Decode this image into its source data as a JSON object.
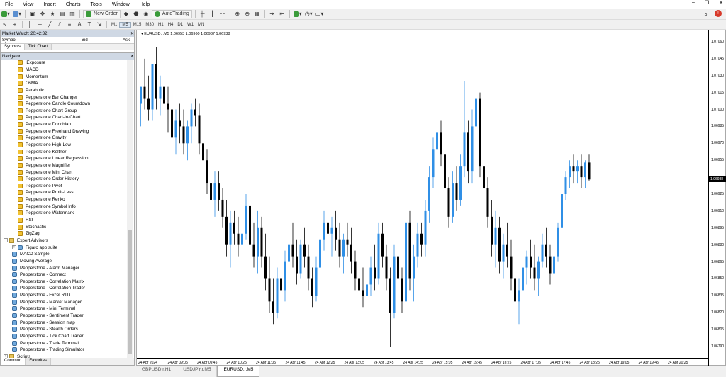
{
  "menu": [
    "File",
    "View",
    "Insert",
    "Charts",
    "Tools",
    "Window",
    "Help"
  ],
  "toolbar": {
    "new_order_label": "New Order",
    "autotrading_label": "AutoTrading",
    "timeframes": [
      "M1",
      "M5",
      "M15",
      "M30",
      "H1",
      "H4",
      "D1",
      "W1",
      "MN"
    ],
    "active_timeframe": "M5"
  },
  "market_watch": {
    "title": "Market Watch: 20:42:32",
    "col_symbol": "Symbol",
    "col_bid": "Bid",
    "col_ask": "Ask",
    "tabs": [
      "Symbols",
      "Tick Chart"
    ]
  },
  "navigator": {
    "title": "Navigator",
    "indicators": [
      "iExposure",
      "MACD",
      "Momentum",
      "OsMA",
      "Parabolic",
      "Pepperstone Bar Changer",
      "Pepperstone Candle Countdown",
      "Pepperstone Chart Group",
      "Pepperstone Chart-In-Chart",
      "Pepperstone Donchian",
      "Pepperstone Freehand Drawing",
      "Pepperstone Gravity",
      "Pepperstone High-Low",
      "Pepperstone Keltner",
      "Pepperstone Linear Regression",
      "Pepperstone Magnifier",
      "Pepperstone Mini Chart",
      "Pepperstone Order History",
      "Pepperstone Pivot",
      "Pepperstone Profit-Less",
      "Pepperstone Renko",
      "Pepperstone Symbol Info",
      "Pepperstone Watermark",
      "RSI",
      "Stochastic",
      "ZigZag"
    ],
    "ea_folder": "Expert Advisors",
    "experts": [
      "Figaro app suite",
      "MACD Sample",
      "Moving Average",
      "Pepperstone - Alarm Manager",
      "Pepperstone - Connect",
      "Pepperstone - Correlation Matrix",
      "Pepperstone - Correlation Trader",
      "Pepperstone - Excel RTD",
      "Pepperstone - Market Manager",
      "Pepperstone - Mini Terminal",
      "Pepperstone - Sentiment Trader",
      "Pepperstone - Session map",
      "Pepperstone - Stealth Orders",
      "Pepperstone - Tick Chart Trader",
      "Pepperstone - Trade Terminal",
      "Pepperstone - Trading Simulator"
    ],
    "scripts_folder": "Scripts",
    "bottom_tabs": [
      "Common",
      "Favorites"
    ]
  },
  "chart": {
    "header": "EURUSD.r,M5  1.06953 1.06960 1.06937 1.06938",
    "price_labels": [
      "1.07060",
      "1.07045",
      "1.07030",
      "1.07015",
      "1.07000",
      "1.06985",
      "1.06970",
      "1.06955",
      "1.06938",
      "1.06925",
      "1.06910",
      "1.06895",
      "1.06880",
      "1.06865",
      "1.06850",
      "1.06835",
      "1.06820",
      "1.06805",
      "1.06790"
    ],
    "current_price": "1.06938",
    "time_labels": [
      "24 Apr 2024",
      "24 Apr 09:05",
      "24 Apr 09:45",
      "24 Apr 10:25",
      "24 Apr 11:05",
      "24 Apr 11:45",
      "24 Apr 12:25",
      "24 Apr 13:05",
      "24 Apr 13:45",
      "24 Apr 14:25",
      "24 Apr 15:05",
      "24 Apr 15:45",
      "24 Apr 16:25",
      "24 Apr 17:05",
      "24 Apr 17:45",
      "24 Apr 18:25",
      "24 Apr 19:05",
      "24 Apr 19:45",
      "24 Apr 20:25"
    ],
    "tabs": [
      "GBPUSD.r,H1",
      "USDJPY.r,M5",
      "EURUSD.r,M5"
    ],
    "active_tab": "EURUSD.r,M5",
    "up_color": "#2f8fe6",
    "down_color": "#000000"
  },
  "chart_data": {
    "type": "candlestick",
    "title": "EURUSD.r,M5",
    "ylim": [
      1.0679,
      1.0707
    ],
    "candles": [
      [
        1.07005,
        1.0702,
        1.06985,
        1.0702
      ],
      [
        1.0702,
        1.07045,
        1.07,
        1.0701
      ],
      [
        1.0701,
        1.0703,
        1.0699,
        1.07
      ],
      [
        1.07,
        1.07015,
        1.0699,
        1.0704
      ],
      [
        1.0704,
        1.07055,
        1.07,
        1.0701
      ],
      [
        1.0701,
        1.0703,
        1.06995,
        1.0702
      ],
      [
        1.0702,
        1.0704,
        1.07,
        1.07005
      ],
      [
        1.07005,
        1.0702,
        1.0698,
        1.07
      ],
      [
        1.07,
        1.0701,
        1.06965,
        1.06975
      ],
      [
        1.06975,
        1.07,
        1.0696,
        1.0699
      ],
      [
        1.0699,
        1.07005,
        1.0697,
        1.06985
      ],
      [
        1.06985,
        1.07,
        1.0696,
        1.0697
      ],
      [
        1.0697,
        1.0699,
        1.06955,
        1.06985
      ],
      [
        1.06985,
        1.07005,
        1.0697,
        1.07
      ],
      [
        1.07,
        1.0701,
        1.06985,
        1.06995
      ],
      [
        1.06995,
        1.07005,
        1.0696,
        1.0697
      ],
      [
        1.0697,
        1.06975,
        1.06945,
        1.06955
      ],
      [
        1.06955,
        1.06965,
        1.06925,
        1.06935
      ],
      [
        1.06935,
        1.06955,
        1.0691,
        1.0692
      ],
      [
        1.0692,
        1.06945,
        1.06905,
        1.06935
      ],
      [
        1.06935,
        1.06945,
        1.0691,
        1.0692
      ],
      [
        1.0692,
        1.0693,
        1.06895,
        1.06905
      ],
      [
        1.06905,
        1.0692,
        1.0687,
        1.0688
      ],
      [
        1.0688,
        1.0691,
        1.0686,
        1.069
      ],
      [
        1.069,
        1.0691,
        1.0688,
        1.0689
      ],
      [
        1.0689,
        1.06905,
        1.0687,
        1.0688
      ],
      [
        1.0688,
        1.069,
        1.0686,
        1.0689
      ],
      [
        1.0689,
        1.06925,
        1.06885,
        1.06915
      ],
      [
        1.06915,
        1.06925,
        1.0687,
        1.0688
      ],
      [
        1.0688,
        1.069,
        1.0686,
        1.0687
      ],
      [
        1.0687,
        1.0691,
        1.06855,
        1.06895
      ],
      [
        1.06895,
        1.06905,
        1.0686,
        1.0687
      ],
      [
        1.0687,
        1.0689,
        1.0684,
        1.0685
      ],
      [
        1.0685,
        1.0687,
        1.0682,
        1.0683
      ],
      [
        1.0683,
        1.0685,
        1.0681,
        1.0682
      ],
      [
        1.0682,
        1.0686,
        1.06815,
        1.0685
      ],
      [
        1.0685,
        1.0687,
        1.0683,
        1.0684
      ],
      [
        1.0684,
        1.06875,
        1.0683,
        1.06865
      ],
      [
        1.06865,
        1.0689,
        1.0685,
        1.0688
      ],
      [
        1.0688,
        1.069,
        1.0686,
        1.0687
      ],
      [
        1.0687,
        1.06885,
        1.06845,
        1.06855
      ],
      [
        1.06855,
        1.06885,
        1.0685,
        1.0688
      ],
      [
        1.0688,
        1.06895,
        1.0686,
        1.0687
      ],
      [
        1.0687,
        1.0688,
        1.0684,
        1.0685
      ],
      [
        1.0685,
        1.0686,
        1.06825,
        1.06835
      ],
      [
        1.06835,
        1.0687,
        1.0683,
        1.0686
      ],
      [
        1.0686,
        1.0689,
        1.06855,
        1.06885
      ],
      [
        1.06885,
        1.0691,
        1.06875,
        1.069
      ],
      [
        1.069,
        1.0692,
        1.0688,
        1.0689
      ],
      [
        1.0689,
        1.06905,
        1.0687,
        1.06895
      ],
      [
        1.06895,
        1.0691,
        1.06875,
        1.06885
      ],
      [
        1.06885,
        1.069,
        1.0686,
        1.0687
      ],
      [
        1.0687,
        1.0689,
        1.06855,
        1.06885
      ],
      [
        1.06885,
        1.069,
        1.0687,
        1.0688
      ],
      [
        1.0688,
        1.06895,
        1.06855,
        1.06865
      ],
      [
        1.06865,
        1.06875,
        1.0684,
        1.0685
      ],
      [
        1.0685,
        1.0686,
        1.0683,
        1.0684
      ],
      [
        1.0684,
        1.0686,
        1.06825,
        1.06835
      ],
      [
        1.06835,
        1.0685,
        1.0683,
        1.06845
      ],
      [
        1.06845,
        1.0687,
        1.06835,
        1.0686
      ],
      [
        1.0686,
        1.0688,
        1.0684,
        1.0685
      ],
      [
        1.0685,
        1.069,
        1.06845,
        1.0689
      ],
      [
        1.0689,
        1.069,
        1.0686,
        1.0687
      ],
      [
        1.0687,
        1.0688,
        1.0684,
        1.0685
      ],
      [
        1.0685,
        1.0686,
        1.0679,
        1.0682
      ],
      [
        1.0682,
        1.0688,
        1.06815,
        1.0687
      ],
      [
        1.0687,
        1.0689,
        1.0684,
        1.0685
      ],
      [
        1.0685,
        1.0686,
        1.0682,
        1.0683
      ],
      [
        1.0683,
        1.06905,
        1.06825,
        1.069
      ],
      [
        1.069,
        1.0691,
        1.0684,
        1.0685
      ],
      [
        1.0685,
        1.0688,
        1.0683,
        1.0687
      ],
      [
        1.0687,
        1.069,
        1.0686,
        1.0689
      ],
      [
        1.0689,
        1.069,
        1.0687,
        1.0688
      ],
      [
        1.0688,
        1.0692,
        1.0687,
        1.0691
      ],
      [
        1.0691,
        1.0695,
        1.069,
        1.0694
      ],
      [
        1.0694,
        1.06975,
        1.0693,
        1.06965
      ],
      [
        1.06965,
        1.0699,
        1.06955,
        1.0698
      ],
      [
        1.0698,
        1.0699,
        1.0695,
        1.0696
      ],
      [
        1.0696,
        1.0697,
        1.0692,
        1.0693
      ],
      [
        1.0693,
        1.0694,
        1.06895,
        1.06905
      ],
      [
        1.06905,
        1.06945,
        1.069,
        1.06935
      ],
      [
        1.06935,
        1.0695,
        1.0691,
        1.0692
      ],
      [
        1.0692,
        1.0696,
        1.06915,
        1.0695
      ],
      [
        1.0695,
        1.07025,
        1.0694,
        1.0698
      ],
      [
        1.0698,
        1.0699,
        1.06935,
        1.06945
      ],
      [
        1.06945,
        1.07,
        1.06935,
        1.06985
      ],
      [
        1.06985,
        1.07015,
        1.06975,
        1.0701
      ],
      [
        1.0701,
        1.07015,
        1.0694,
        1.0695
      ],
      [
        1.0695,
        1.0696,
        1.0692,
        1.0693
      ],
      [
        1.0693,
        1.0694,
        1.06895,
        1.06905
      ],
      [
        1.06905,
        1.0692,
        1.0687,
        1.0688
      ],
      [
        1.0688,
        1.0691,
        1.0686,
        1.06895
      ],
      [
        1.06895,
        1.06905,
        1.06855,
        1.06865
      ],
      [
        1.06865,
        1.0689,
        1.0685,
        1.0688
      ],
      [
        1.0688,
        1.069,
        1.0686,
        1.0687
      ],
      [
        1.0687,
        1.06885,
        1.0684,
        1.0685
      ],
      [
        1.0685,
        1.0687,
        1.0682,
        1.0683
      ],
      [
        1.0683,
        1.0685,
        1.0681,
        1.0684
      ],
      [
        1.0684,
        1.06865,
        1.0683,
        1.0686
      ],
      [
        1.0686,
        1.06875,
        1.06845,
        1.0687
      ],
      [
        1.0687,
        1.06885,
        1.0685,
        1.0686
      ],
      [
        1.0686,
        1.0688,
        1.0684,
        1.0685
      ],
      [
        1.0685,
        1.0687,
        1.06835,
        1.06865
      ],
      [
        1.06865,
        1.0689,
        1.0686,
        1.0688
      ],
      [
        1.0688,
        1.06895,
        1.0686,
        1.0687
      ],
      [
        1.0687,
        1.0688,
        1.06845,
        1.06855
      ],
      [
        1.06855,
        1.06875,
        1.0685,
        1.0687
      ],
      [
        1.0687,
        1.069,
        1.06865,
        1.06895
      ],
      [
        1.06895,
        1.0693,
        1.0689,
        1.06925
      ],
      [
        1.06925,
        1.06945,
        1.0692,
        1.0694
      ],
      [
        1.0694,
        1.06955,
        1.0693,
        1.0695
      ],
      [
        1.0695,
        1.0696,
        1.06935,
        1.06945
      ],
      [
        1.06945,
        1.06955,
        1.06935,
        1.0695
      ],
      [
        1.0695,
        1.0696,
        1.0693,
        1.0694
      ],
      [
        1.0694,
        1.06955,
        1.0693,
        1.06953
      ],
      [
        1.06953,
        1.0696,
        1.06937,
        1.06938
      ]
    ]
  }
}
